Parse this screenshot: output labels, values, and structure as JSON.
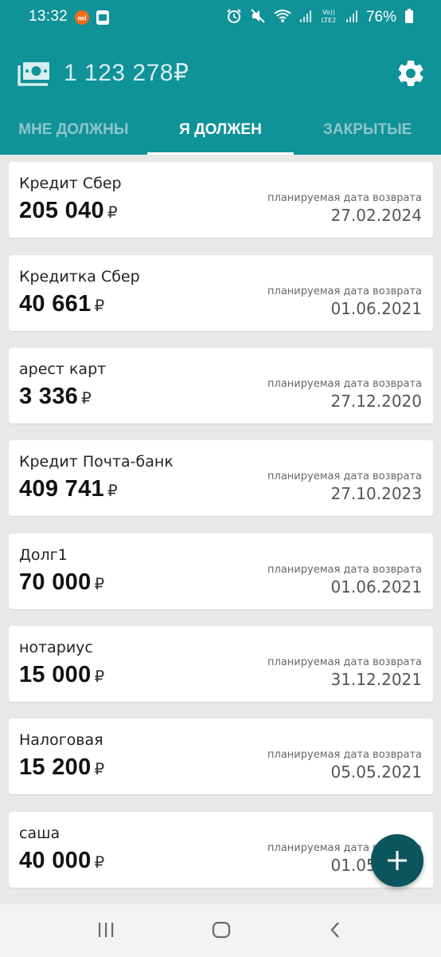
{
  "status_bar": {
    "time": "13:32",
    "battery": "76%",
    "icons": [
      "mi-app-icon",
      "gallery-icon",
      "alarm-icon",
      "mute-icon",
      "wifi-icon",
      "signal-icon",
      "volte-icon",
      "signal-icon",
      "battery-icon"
    ]
  },
  "header": {
    "total": "1 123 278₽",
    "wallet_icon": "money-icon",
    "settings_icon": "gear-icon"
  },
  "tabs": [
    {
      "label": "МНЕ ДОЛЖНЫ",
      "active": false
    },
    {
      "label": "Я ДОЛЖЕН",
      "active": true
    },
    {
      "label": "ЗАКРЫТЫЕ",
      "active": false
    }
  ],
  "debts": [
    {
      "name": "Кредит Сбер",
      "amount": "205 040",
      "currency": "₽",
      "date_label": "планируемая дата возврата",
      "date": "27.02.2024"
    },
    {
      "name": "Кредитка Сбер",
      "amount": "40 661",
      "currency": "₽",
      "date_label": "планируемая дата возврата",
      "date": "01.06.2021"
    },
    {
      "name": "арест карт",
      "amount": "3 336",
      "currency": "₽",
      "date_label": "планируемая дата возврата",
      "date": "27.12.2020"
    },
    {
      "name": "Кредит Почта-банк",
      "amount": "409 741",
      "currency": "₽",
      "date_label": "планируемая дата возврата",
      "date": "27.10.2023"
    },
    {
      "name": "Долг1",
      "amount": "70 000",
      "currency": "₽",
      "date_label": "планируемая дата возврата",
      "date": "01.06.2021"
    },
    {
      "name": "нотариус",
      "amount": "15 000",
      "currency": "₽",
      "date_label": "планируемая дата возврата",
      "date": "31.12.2021"
    },
    {
      "name": "Налоговая",
      "amount": "15 200",
      "currency": "₽",
      "date_label": "планируемая дата возврата",
      "date": "05.05.2021"
    },
    {
      "name": "саша",
      "amount": "40 000",
      "currency": "₽",
      "date_label": "планируемая дата возврата",
      "date": "01.05.2021"
    }
  ],
  "fab": {
    "icon": "plus-icon"
  },
  "nav_bar": {
    "buttons": [
      "recents-icon",
      "home-icon",
      "back-icon"
    ]
  },
  "colors": {
    "primary": "#0f9298",
    "fab": "#0b555c",
    "background": "#e8e8e8"
  }
}
